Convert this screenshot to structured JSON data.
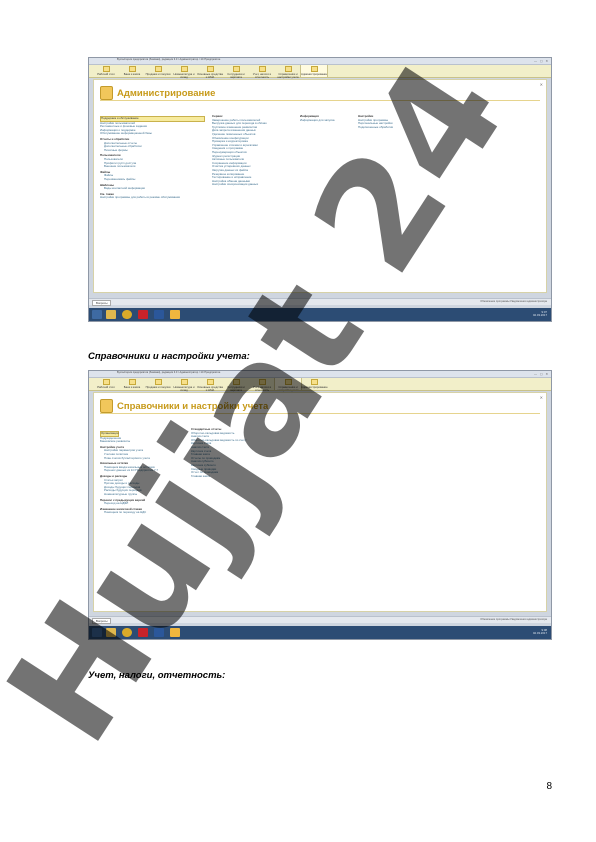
{
  "screenshot1": {
    "window_title": "Бухгалтерия предприятия (базовая), редакция 3.0 / Администратор / 1С:Предприятие",
    "sections": [
      "Рабочий стол",
      "Банк и касса",
      "Продажи и покупки",
      "Номенклатура и склад",
      "Основные средства и НМА",
      "Сотрудники и зарплата",
      "Учет, налоги и отчетность",
      "Справочники и настройки учета",
      "Администрирование"
    ],
    "active_section_index": 8,
    "title": "Администрирование",
    "col1": {
      "highlight": "Поддержка и обслуживание",
      "items1": [
        "Поддержка и обслуживание",
        "Настройки пользователей",
        "Регламентные и фоновые задания",
        "Информация о поддержке",
        "Обслуживание информационной базы"
      ],
      "group2": "Отчеты и обработки",
      "items2": [
        "Дополнительные отчеты",
        "Дополнительные обработки",
        "Печатные формы"
      ],
      "group3": "Пользователи",
      "items3": [
        "Пользователи",
        "Профили групп доступа",
        "Внешние пользователи"
      ],
      "group4": "Файлы",
      "items4": [
        "Файлы",
        "Переименовать файлы"
      ],
      "group5": "Шаблоны",
      "items5": [
        "Виды контактной информации"
      ],
      "group6": "См. также",
      "items6": [
        "Настройки программы для работы в режиме обслуживания"
      ]
    },
    "col2": {
      "header": "Сервис",
      "items": [
        "Завершение работы пользователей",
        "Выгрузка данных для перехода в облако",
        "Групповое изменение реквизитов",
        "Дата запрета изменения данных",
        "Удаление помеченных объектов",
        "Обновление конфигурации",
        "Проверка и корректировка",
        "Управление итогами и агрегатами",
        "Сведения о программе",
        "Перенумерация объектов",
        "Журнал регистрации",
        "Активные пользователи",
        "Сохранение информации",
        "Очистка устаревших данных",
        "Загрузка данных из файла",
        "Резервное копирование",
        "Тестирование и исправление",
        "Настройка обмена данными",
        "Настройки синхронизации данных"
      ]
    },
    "col3": {
      "header": "Информация",
      "items": [
        "Информация для запуска"
      ]
    },
    "col4": {
      "header": "Настройки",
      "items": [
        "Настройки программы",
        "Персональные настройки",
        "Подключенные обработки"
      ]
    },
    "status_left": "Вопросы",
    "status_right": "Обновление программы   Уведомления администратора",
    "tray_time": "9:07",
    "tray_date": "02.03.2017"
  },
  "caption1": "Справочники и настройки учета:",
  "screenshot2": {
    "window_title": "Бухгалтерия предприятия (базовая), редакция 3.0 / Администратор / 1С:Предприятие",
    "sections": [
      "Рабочий стол",
      "Банк и касса",
      "Продажи и покупки",
      "Номенклатура и склад",
      "Основные средства и НМА",
      "Сотрудники и зарплата",
      "Учет, налоги и отчетность",
      "Справочники и настройки учета",
      "Администрирование"
    ],
    "active_section_index": 7,
    "title": "Справочники и настройки учета",
    "col1": {
      "highlight": "Организации",
      "items1": [
        "Организации",
        "Подразделения",
        "Банковские реквизиты"
      ],
      "group2": "Настройки учета",
      "items2": [
        "Настройки параметров учета",
        "Учетная политика",
        "План счетов бухгалтерского учета"
      ],
      "group3": "Начальные остатки",
      "items3": [
        "Помощник ввода начальных остатков",
        "Перенос данных из 1С:Предприятия 7.7"
      ],
      "group4": "Доходы и расходы",
      "items4": [
        "Статьи затрат",
        "Прочие доходы и расходы",
        "Доходы будущих периодов",
        "Расходы будущих периодов",
        "Номенклатурные группы"
      ],
      "group5": "Перенос с предыдущих версий",
      "items5": [
        "Переход на НДФЛ"
      ],
      "group6": "Изменение налоговой ставки",
      "items6": [
        "Помощник по переходу на НДС"
      ]
    },
    "col2": {
      "header": "Стандартные отчеты",
      "items": [
        "Оборотно-сальдовая ведомость",
        "Анализ счета",
        "Оборотно-сальдовая ведомость по счету",
        "Карточка счета",
        "Анализ счета",
        "Карточка счета",
        "Главная книга",
        "Отчеты по проводкам",
        "Анализ субконто",
        "Карточка субконто",
        "Сводные проводки",
        "Отчет по проводкам",
        "Главная книга"
      ]
    },
    "status_left": "Вопросы",
    "status_right": "Обновление программы   Уведомления администратора",
    "tray_time": "9:08",
    "tray_date": "02.03.2017"
  },
  "caption2": "Учет, налоги, отчетность:",
  "page_number": "8",
  "watermark_text": "Hujjat 24"
}
